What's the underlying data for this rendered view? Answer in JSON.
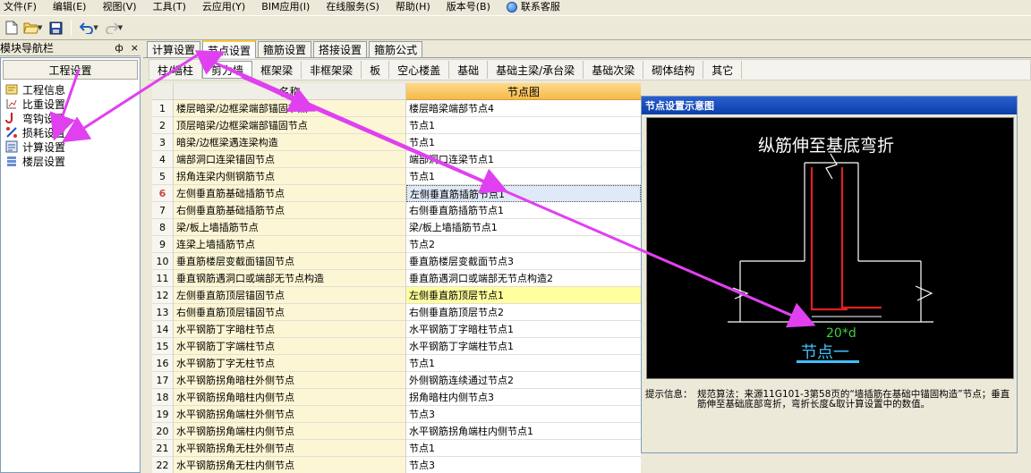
{
  "menu": [
    "文件(F)",
    "编辑(E)",
    "视图(V)",
    "工具(T)",
    "云应用(Y)",
    "BIM应用(I)",
    "在线服务(S)",
    "帮助(H)",
    "版本号(B)"
  ],
  "support_label": "联系客服",
  "nav": {
    "title": "模块导航栏",
    "pin": "ф",
    "close": "×",
    "group": "工程设置",
    "items": [
      "工程信息",
      "比重设置",
      "弯钩设置",
      "损耗设置",
      "计算设置",
      "楼层设置"
    ]
  },
  "tabs": [
    "计算设置",
    "节点设置",
    "箍筋设置",
    "搭接设置",
    "箍筋公式"
  ],
  "subtabs": [
    "柱/墙柱",
    "剪力墙",
    "框架梁",
    "非框架梁",
    "板",
    "空心楼盖",
    "基础",
    "基础主梁/承台梁",
    "基础次梁",
    "砌体结构",
    "其它"
  ],
  "grid": {
    "col_name": "名称",
    "col_node": "节点图",
    "rows": [
      {
        "n": "1",
        "name": "楼层暗梁/边框梁端部锚固节点",
        "node": "楼层暗梁端部节点4"
      },
      {
        "n": "2",
        "name": "顶层暗梁/边框梁端部锚固节点",
        "node": "节点1"
      },
      {
        "n": "3",
        "name": "暗梁/边框梁遇连梁构造",
        "node": "节点1"
      },
      {
        "n": "4",
        "name": "端部洞口连梁锚固节点",
        "node": "端部洞口连梁节点1"
      },
      {
        "n": "5",
        "name": "拐角连梁内侧钢筋节点",
        "node": "节点1"
      },
      {
        "n": "6",
        "name": "左侧垂直筋基础插筋节点",
        "node": "左侧垂直筋插筋节点1"
      },
      {
        "n": "7",
        "name": "右侧垂直筋基础插筋节点",
        "node": "右侧垂直筋插筋节点1"
      },
      {
        "n": "8",
        "name": "梁/板上墙插筋节点",
        "node": "梁/板上墙插筋节点1"
      },
      {
        "n": "9",
        "name": "连梁上墙插筋节点",
        "node": "节点2"
      },
      {
        "n": "10",
        "name": "垂直筋楼层变截面锚固节点",
        "node": "垂直筋楼层变截面节点3"
      },
      {
        "n": "11",
        "name": "垂直钢筋遇洞口或端部无节点构造",
        "node": "垂直筋遇洞口或端部无节点构造2"
      },
      {
        "n": "12",
        "name": "左侧垂直筋顶层锚固节点",
        "node": "左侧垂直筋顶层节点1"
      },
      {
        "n": "13",
        "name": "右侧垂直筋顶层锚固节点",
        "node": "右侧垂直筋顶层节点2"
      },
      {
        "n": "14",
        "name": "水平钢筋丁字暗柱节点",
        "node": "水平钢筋丁字暗柱节点1"
      },
      {
        "n": "15",
        "name": "水平钢筋丁字端柱节点",
        "node": "水平钢筋丁字端柱节点1"
      },
      {
        "n": "16",
        "name": "水平钢筋丁字无柱节点",
        "node": "节点1"
      },
      {
        "n": "17",
        "name": "水平钢筋拐角暗柱外侧节点",
        "node": "外侧钢筋连续通过节点2"
      },
      {
        "n": "18",
        "name": "水平钢筋拐角暗柱内侧节点",
        "node": "拐角暗柱内侧节点3"
      },
      {
        "n": "19",
        "name": "水平钢筋拐角端柱外侧节点",
        "node": "节点3"
      },
      {
        "n": "20",
        "name": "水平钢筋拐角端柱内侧节点",
        "node": "水平钢筋拐角端柱内侧节点1"
      },
      {
        "n": "21",
        "name": "水平钢筋拐角无柱外侧节点",
        "node": "节点1"
      },
      {
        "n": "22",
        "name": "水平钢筋拐角无柱内侧节点",
        "node": "节点3"
      }
    ]
  },
  "preview": {
    "title": "节点设置示意图",
    "diagram_title": "纵筋伸至基底弯折",
    "dim_label": "20*d",
    "node_label": "节点一",
    "info_label": "提示信息：",
    "info_text": "规范算法：来源11G101-3第58页的“墙插筋在基础中锚固构造”节点；垂直筋伸至基础底部弯折，弯折长度&取计算设置中的数值。"
  },
  "colors": {
    "annotation_arrow": "#e040f0",
    "rebar": "#e02020",
    "dim_text": "#40d040",
    "node_text": "#40c0ff"
  }
}
